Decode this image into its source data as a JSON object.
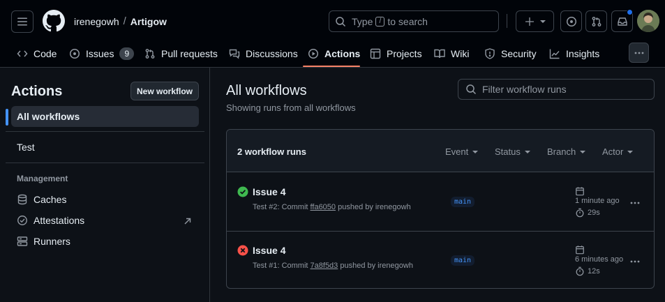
{
  "header": {
    "owner": "irenegowh",
    "separator": "/",
    "repo": "Artigow",
    "search_prefix": "Type",
    "search_key": "/",
    "search_suffix": "to search"
  },
  "tabs": [
    {
      "label": "Code",
      "icon": "code-icon"
    },
    {
      "label": "Issues",
      "icon": "issue-icon",
      "count": "9"
    },
    {
      "label": "Pull requests",
      "icon": "pull-request-icon"
    },
    {
      "label": "Discussions",
      "icon": "discussion-icon"
    },
    {
      "label": "Actions",
      "icon": "play-icon",
      "active": true
    },
    {
      "label": "Projects",
      "icon": "table-icon"
    },
    {
      "label": "Wiki",
      "icon": "book-icon"
    },
    {
      "label": "Security",
      "icon": "shield-icon"
    },
    {
      "label": "Insights",
      "icon": "graph-icon"
    }
  ],
  "sidebar": {
    "title": "Actions",
    "new_workflow": "New workflow",
    "all_workflows": "All workflows",
    "workflows": [
      "Test"
    ],
    "management_heading": "Management",
    "management": [
      {
        "label": "Caches",
        "icon": "database-icon"
      },
      {
        "label": "Attestations",
        "icon": "verified-icon"
      },
      {
        "label": "Runners",
        "icon": "server-icon"
      }
    ]
  },
  "main": {
    "title": "All workflows",
    "subtitle": "Showing runs from all workflows",
    "filter_placeholder": "Filter workflow runs",
    "runs_count": "2 workflow runs",
    "filters": [
      "Event",
      "Status",
      "Branch",
      "Actor"
    ],
    "runs": [
      {
        "status": "success",
        "title": "Issue 4",
        "meta_prefix": "Test #2: Commit",
        "commit": "ffa6050",
        "meta_suffix": "pushed by irenegowh",
        "branch": "main",
        "time": "1 minute ago",
        "duration": "29s"
      },
      {
        "status": "failure",
        "title": "Issue 4",
        "meta_prefix": "Test #1: Commit",
        "commit": "7a8f5d3",
        "meta_suffix": "pushed by irenegowh",
        "branch": "main",
        "time": "6 minutes ago",
        "duration": "12s"
      }
    ]
  },
  "colors": {
    "success": "#3fb950",
    "failure": "#f85149",
    "accent": "#4493f8",
    "tab_underline": "#f78166"
  }
}
